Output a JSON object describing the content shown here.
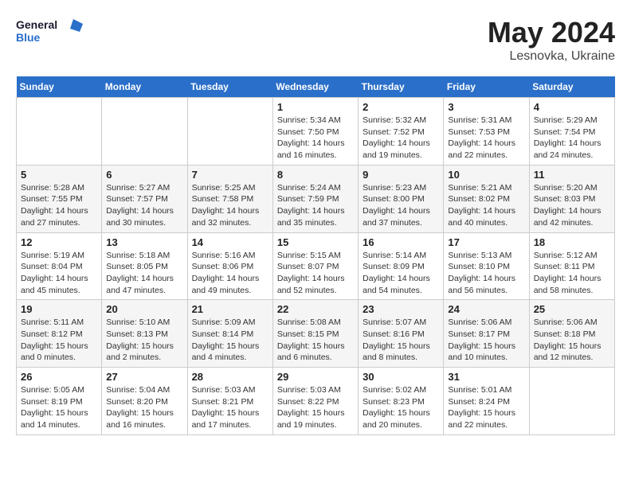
{
  "logo": {
    "line1": "General",
    "line2": "Blue"
  },
  "title": "May 2024",
  "location": "Lesnovka, Ukraine",
  "weekdays": [
    "Sunday",
    "Monday",
    "Tuesday",
    "Wednesday",
    "Thursday",
    "Friday",
    "Saturday"
  ],
  "weeks": [
    [
      {
        "day": "",
        "info": ""
      },
      {
        "day": "",
        "info": ""
      },
      {
        "day": "",
        "info": ""
      },
      {
        "day": "1",
        "info": "Sunrise: 5:34 AM\nSunset: 7:50 PM\nDaylight: 14 hours\nand 16 minutes."
      },
      {
        "day": "2",
        "info": "Sunrise: 5:32 AM\nSunset: 7:52 PM\nDaylight: 14 hours\nand 19 minutes."
      },
      {
        "day": "3",
        "info": "Sunrise: 5:31 AM\nSunset: 7:53 PM\nDaylight: 14 hours\nand 22 minutes."
      },
      {
        "day": "4",
        "info": "Sunrise: 5:29 AM\nSunset: 7:54 PM\nDaylight: 14 hours\nand 24 minutes."
      }
    ],
    [
      {
        "day": "5",
        "info": "Sunrise: 5:28 AM\nSunset: 7:55 PM\nDaylight: 14 hours\nand 27 minutes."
      },
      {
        "day": "6",
        "info": "Sunrise: 5:27 AM\nSunset: 7:57 PM\nDaylight: 14 hours\nand 30 minutes."
      },
      {
        "day": "7",
        "info": "Sunrise: 5:25 AM\nSunset: 7:58 PM\nDaylight: 14 hours\nand 32 minutes."
      },
      {
        "day": "8",
        "info": "Sunrise: 5:24 AM\nSunset: 7:59 PM\nDaylight: 14 hours\nand 35 minutes."
      },
      {
        "day": "9",
        "info": "Sunrise: 5:23 AM\nSunset: 8:00 PM\nDaylight: 14 hours\nand 37 minutes."
      },
      {
        "day": "10",
        "info": "Sunrise: 5:21 AM\nSunset: 8:02 PM\nDaylight: 14 hours\nand 40 minutes."
      },
      {
        "day": "11",
        "info": "Sunrise: 5:20 AM\nSunset: 8:03 PM\nDaylight: 14 hours\nand 42 minutes."
      }
    ],
    [
      {
        "day": "12",
        "info": "Sunrise: 5:19 AM\nSunset: 8:04 PM\nDaylight: 14 hours\nand 45 minutes."
      },
      {
        "day": "13",
        "info": "Sunrise: 5:18 AM\nSunset: 8:05 PM\nDaylight: 14 hours\nand 47 minutes."
      },
      {
        "day": "14",
        "info": "Sunrise: 5:16 AM\nSunset: 8:06 PM\nDaylight: 14 hours\nand 49 minutes."
      },
      {
        "day": "15",
        "info": "Sunrise: 5:15 AM\nSunset: 8:07 PM\nDaylight: 14 hours\nand 52 minutes."
      },
      {
        "day": "16",
        "info": "Sunrise: 5:14 AM\nSunset: 8:09 PM\nDaylight: 14 hours\nand 54 minutes."
      },
      {
        "day": "17",
        "info": "Sunrise: 5:13 AM\nSunset: 8:10 PM\nDaylight: 14 hours\nand 56 minutes."
      },
      {
        "day": "18",
        "info": "Sunrise: 5:12 AM\nSunset: 8:11 PM\nDaylight: 14 hours\nand 58 minutes."
      }
    ],
    [
      {
        "day": "19",
        "info": "Sunrise: 5:11 AM\nSunset: 8:12 PM\nDaylight: 15 hours\nand 0 minutes."
      },
      {
        "day": "20",
        "info": "Sunrise: 5:10 AM\nSunset: 8:13 PM\nDaylight: 15 hours\nand 2 minutes."
      },
      {
        "day": "21",
        "info": "Sunrise: 5:09 AM\nSunset: 8:14 PM\nDaylight: 15 hours\nand 4 minutes."
      },
      {
        "day": "22",
        "info": "Sunrise: 5:08 AM\nSunset: 8:15 PM\nDaylight: 15 hours\nand 6 minutes."
      },
      {
        "day": "23",
        "info": "Sunrise: 5:07 AM\nSunset: 8:16 PM\nDaylight: 15 hours\nand 8 minutes."
      },
      {
        "day": "24",
        "info": "Sunrise: 5:06 AM\nSunset: 8:17 PM\nDaylight: 15 hours\nand 10 minutes."
      },
      {
        "day": "25",
        "info": "Sunrise: 5:06 AM\nSunset: 8:18 PM\nDaylight: 15 hours\nand 12 minutes."
      }
    ],
    [
      {
        "day": "26",
        "info": "Sunrise: 5:05 AM\nSunset: 8:19 PM\nDaylight: 15 hours\nand 14 minutes."
      },
      {
        "day": "27",
        "info": "Sunrise: 5:04 AM\nSunset: 8:20 PM\nDaylight: 15 hours\nand 16 minutes."
      },
      {
        "day": "28",
        "info": "Sunrise: 5:03 AM\nSunset: 8:21 PM\nDaylight: 15 hours\nand 17 minutes."
      },
      {
        "day": "29",
        "info": "Sunrise: 5:03 AM\nSunset: 8:22 PM\nDaylight: 15 hours\nand 19 minutes."
      },
      {
        "day": "30",
        "info": "Sunrise: 5:02 AM\nSunset: 8:23 PM\nDaylight: 15 hours\nand 20 minutes."
      },
      {
        "day": "31",
        "info": "Sunrise: 5:01 AM\nSunset: 8:24 PM\nDaylight: 15 hours\nand 22 minutes."
      },
      {
        "day": "",
        "info": ""
      }
    ]
  ]
}
